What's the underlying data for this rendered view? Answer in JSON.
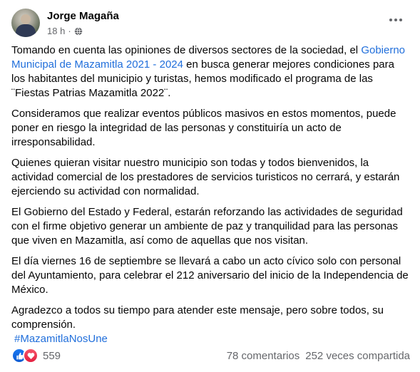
{
  "post": {
    "author": "Jorge Magaña",
    "time": "18 h",
    "separator": "·",
    "paragraphs": {
      "p1_before": "Tomando en cuenta las opiniones de diversos sectores de la sociedad, el ",
      "p1_link": "Gobierno Municipal de Mazamitla 2021 - 2024",
      "p1_after": " en busca generar mejores condiciones para los habitantes del municipio y turistas, hemos modificado el programa de las ¨Fiestas Patrias Mazamitla 2022¨.",
      "p2": "Consideramos que realizar eventos públicos masivos en estos momentos, puede poner en riesgo la integridad de las personas y constituiría un acto de irresponsabilidad.",
      "p3": "Quienes quieran visitar nuestro municipio son todas y todos bienvenidos, la actividad comercial de los prestadores de servicios turisticos no cerrará, y estarán ejerciendo su actividad con normalidad.",
      "p4": "El Gobierno del Estado y Federal, estarán reforzando las actividades de seguridad con el firme objetivo generar un ambiente de paz y tranquilidad para las personas que viven en Mazamitla, así como de aquellas que nos visitan.",
      "p5": "El día viernes 16 de septiembre se llevará a cabo un acto cívico solo con personal del Ayuntamiento, para celebrar el 212 aniversario del inicio de la Independencia de México.",
      "p6": "Agradezco a todos su tiempo para atender este mensaje, pero sobre todos, su comprensión."
    },
    "hashtag": "#MazamitlaNosUne"
  },
  "footer": {
    "reactions_count": "559",
    "comments": "78 comentarios",
    "shares": "252 veces compartida"
  },
  "colors": {
    "link": "#216fdb",
    "like": "#1877f2",
    "love": "#e41e3f",
    "muted": "#65676b"
  },
  "icons": [
    "globe-icon",
    "more-options-icon",
    "like-reaction-icon",
    "love-reaction-icon"
  ]
}
